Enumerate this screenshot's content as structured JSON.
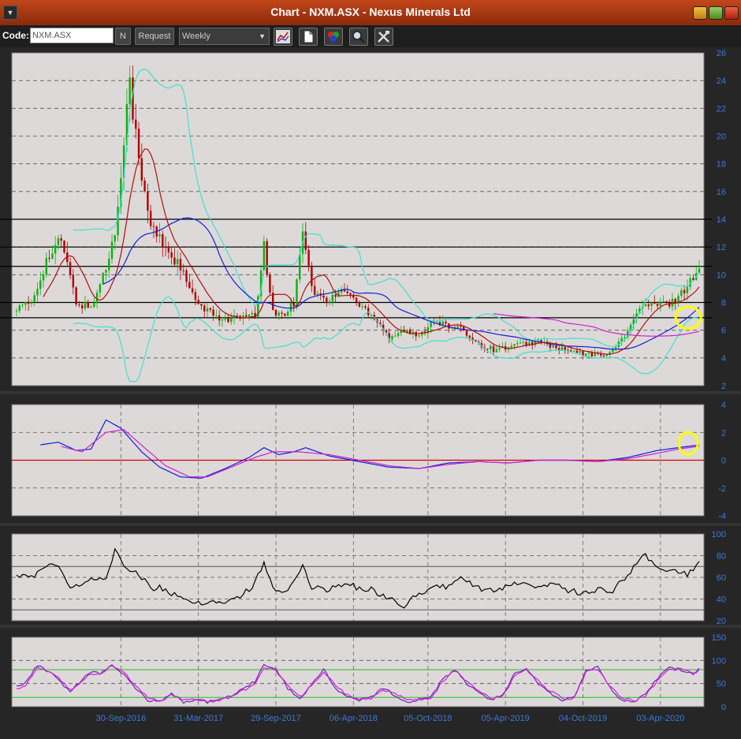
{
  "window": {
    "title": "Chart - NXM.ASX - Nexus Minerals Ltd"
  },
  "toolbar": {
    "code_label": "Code:",
    "code_value": "NXM.ASX",
    "n_label": "N",
    "request_label": "Request",
    "period_value": "Weekly"
  },
  "colors": {
    "background": "#ddd9d8",
    "ma_short": "#b01010",
    "ma_long": "#1020d8",
    "bollinger": "#40e0d0",
    "ma_very_long": "#d020d0",
    "highlight": "#ffff00",
    "up_candle": "#10b010",
    "down_candle": "#b00000"
  },
  "chart_data": [
    {
      "panel": "price",
      "type": "candlestick",
      "y_ticks": [
        "2",
        "4",
        "6",
        "8",
        "10",
        "12",
        "14",
        "16",
        "18",
        "20",
        "22",
        "24",
        "26"
      ],
      "ylim": [
        2,
        26
      ],
      "horizontal_lines": [
        6.9,
        8.0,
        10.6,
        12.0,
        14.0
      ],
      "weeks": 230,
      "close_anchors": [
        [
          0,
          7.5
        ],
        [
          5,
          8.0
        ],
        [
          10,
          11.0
        ],
        [
          15,
          12.5
        ],
        [
          20,
          8.0
        ],
        [
          25,
          7.6
        ],
        [
          30,
          10.5
        ],
        [
          33,
          13.0
        ],
        [
          36,
          20.0
        ],
        [
          38,
          24.0
        ],
        [
          41,
          18.0
        ],
        [
          45,
          13.5
        ],
        [
          50,
          12.0
        ],
        [
          55,
          10.5
        ],
        [
          60,
          8.0
        ],
        [
          65,
          7.2
        ],
        [
          70,
          6.8
        ],
        [
          75,
          6.9
        ],
        [
          80,
          7.0
        ],
        [
          83,
          12.0
        ],
        [
          86,
          7.2
        ],
        [
          90,
          7.2
        ],
        [
          93,
          8.0
        ],
        [
          96,
          13.5
        ],
        [
          99,
          9.0
        ],
        [
          104,
          8.0
        ],
        [
          110,
          9.0
        ],
        [
          115,
          7.8
        ],
        [
          120,
          7.0
        ],
        [
          125,
          5.5
        ],
        [
          130,
          6.0
        ],
        [
          135,
          5.5
        ],
        [
          140,
          6.8
        ],
        [
          145,
          6.2
        ],
        [
          150,
          6.0
        ],
        [
          155,
          5.0
        ],
        [
          160,
          4.6
        ],
        [
          165,
          4.8
        ],
        [
          170,
          5.0
        ],
        [
          175,
          5.2
        ],
        [
          180,
          4.8
        ],
        [
          185,
          4.5
        ],
        [
          190,
          4.3
        ],
        [
          195,
          4.2
        ],
        [
          200,
          4.5
        ],
        [
          205,
          6.0
        ],
        [
          210,
          7.8
        ],
        [
          215,
          7.8
        ],
        [
          220,
          8.0
        ],
        [
          225,
          9.2
        ],
        [
          229,
          10.6
        ]
      ],
      "highlight_circle": {
        "week": 224,
        "value": 6.9
      }
    },
    {
      "panel": "macd",
      "type": "line",
      "y_ticks": [
        "4",
        "2",
        "0",
        "-2",
        "-4"
      ],
      "ylim": [
        -4,
        4
      ],
      "series": [
        {
          "line": "blue",
          "anchors": [
            [
              8,
              1.1
            ],
            [
              14,
              1.3
            ],
            [
              20,
              0.7
            ],
            [
              25,
              0.8
            ],
            [
              30,
              2.9
            ],
            [
              35,
              2.3
            ],
            [
              42,
              0.6
            ],
            [
              48,
              -0.5
            ],
            [
              55,
              -1.2
            ],
            [
              62,
              -1.3
            ],
            [
              70,
              -0.6
            ],
            [
              78,
              0.2
            ],
            [
              83,
              0.9
            ],
            [
              88,
              0.4
            ],
            [
              93,
              0.6
            ],
            [
              97,
              0.9
            ],
            [
              105,
              0.3
            ],
            [
              115,
              -0.1
            ],
            [
              125,
              -0.5
            ],
            [
              135,
              -0.6
            ],
            [
              145,
              -0.2
            ],
            [
              155,
              -0.1
            ],
            [
              165,
              -0.2
            ],
            [
              175,
              0.0
            ],
            [
              185,
              0.0
            ],
            [
              195,
              -0.1
            ],
            [
              205,
              0.2
            ],
            [
              215,
              0.7
            ],
            [
              222,
              0.9
            ],
            [
              229,
              1.1
            ]
          ]
        },
        {
          "line": "magenta",
          "anchors": [
            [
              15,
              1.0
            ],
            [
              22,
              0.6
            ],
            [
              30,
              2.0
            ],
            [
              36,
              2.2
            ],
            [
              44,
              0.7
            ],
            [
              50,
              -0.4
            ],
            [
              58,
              -1.2
            ],
            [
              64,
              -1.2
            ],
            [
              72,
              -0.5
            ],
            [
              80,
              0.2
            ],
            [
              86,
              0.6
            ],
            [
              95,
              0.6
            ],
            [
              105,
              0.4
            ],
            [
              115,
              0.0
            ],
            [
              125,
              -0.4
            ],
            [
              135,
              -0.6
            ],
            [
              145,
              -0.3
            ],
            [
              155,
              -0.1
            ],
            [
              165,
              -0.2
            ],
            [
              175,
              0.0
            ],
            [
              185,
              0.0
            ],
            [
              195,
              -0.1
            ],
            [
              205,
              0.1
            ],
            [
              215,
              0.5
            ],
            [
              222,
              0.8
            ],
            [
              229,
              1.0
            ]
          ]
        }
      ],
      "zero_line": 0,
      "highlight_circle": {
        "week": 224,
        "value": 1.1
      }
    },
    {
      "panel": "rsi",
      "type": "line",
      "y_ticks": [
        "100",
        "80",
        "60",
        "40",
        "20"
      ],
      "ylim": [
        20,
        100
      ],
      "guide_lines": [
        70,
        30
      ],
      "series": [
        {
          "line": "black",
          "anchors": [
            [
              0,
              62
            ],
            [
              5,
              60
            ],
            [
              10,
              72
            ],
            [
              15,
              68
            ],
            [
              18,
              50
            ],
            [
              22,
              52
            ],
            [
              26,
              58
            ],
            [
              30,
              60
            ],
            [
              33,
              85
            ],
            [
              36,
              70
            ],
            [
              40,
              66
            ],
            [
              45,
              50
            ],
            [
              50,
              50
            ],
            [
              55,
              40
            ],
            [
              60,
              36
            ],
            [
              65,
              38
            ],
            [
              70,
              35
            ],
            [
              75,
              42
            ],
            [
              80,
              55
            ],
            [
              83,
              72
            ],
            [
              86,
              50
            ],
            [
              90,
              45
            ],
            [
              93,
              55
            ],
            [
              96,
              72
            ],
            [
              99,
              50
            ],
            [
              105,
              48
            ],
            [
              110,
              55
            ],
            [
              115,
              50
            ],
            [
              120,
              48
            ],
            [
              125,
              40
            ],
            [
              130,
              33
            ],
            [
              135,
              45
            ],
            [
              140,
              50
            ],
            [
              145,
              52
            ],
            [
              150,
              60
            ],
            [
              155,
              50
            ],
            [
              160,
              48
            ],
            [
              165,
              52
            ],
            [
              170,
              55
            ],
            [
              175,
              50
            ],
            [
              180,
              55
            ],
            [
              185,
              48
            ],
            [
              190,
              45
            ],
            [
              195,
              50
            ],
            [
              200,
              48
            ],
            [
              205,
              62
            ],
            [
              210,
              82
            ],
            [
              215,
              68
            ],
            [
              220,
              68
            ],
            [
              225,
              62
            ],
            [
              229,
              72
            ]
          ]
        }
      ]
    },
    {
      "panel": "stochastic",
      "type": "line",
      "y_ticks": [
        "150",
        "100",
        "50",
        "0"
      ],
      "ylim": [
        0,
        150
      ],
      "guide_lines": [
        80,
        20
      ],
      "x_ticks": [
        "30-Sep-2016",
        "31-Mar-2017",
        "29-Sep-2017",
        "06-Apr-2018",
        "05-Oct-2018",
        "05-Apr-2019",
        "04-Oct-2019",
        "03-Apr-2020"
      ],
      "x_tick_weeks": [
        35,
        61,
        87,
        113,
        138,
        164,
        190,
        216
      ],
      "series": [
        {
          "line": "purple",
          "anchors": [
            [
              0,
              45
            ],
            [
              3,
              50
            ],
            [
              7,
              90
            ],
            [
              11,
              75
            ],
            [
              14,
              60
            ],
            [
              18,
              30
            ],
            [
              22,
              60
            ],
            [
              25,
              75
            ],
            [
              28,
              70
            ],
            [
              32,
              90
            ],
            [
              36,
              70
            ],
            [
              40,
              40
            ],
            [
              44,
              15
            ],
            [
              48,
              10
            ],
            [
              52,
              30
            ],
            [
              56,
              10
            ],
            [
              60,
              15
            ],
            [
              64,
              10
            ],
            [
              68,
              15
            ],
            [
              72,
              25
            ],
            [
              76,
              40
            ],
            [
              80,
              55
            ],
            [
              83,
              90
            ],
            [
              87,
              80
            ],
            [
              91,
              40
            ],
            [
              95,
              15
            ],
            [
              99,
              50
            ],
            [
              103,
              80
            ],
            [
              107,
              40
            ],
            [
              111,
              20
            ],
            [
              115,
              15
            ],
            [
              119,
              20
            ],
            [
              123,
              40
            ],
            [
              127,
              25
            ],
            [
              131,
              10
            ],
            [
              135,
              15
            ],
            [
              139,
              20
            ],
            [
              143,
              60
            ],
            [
              147,
              80
            ],
            [
              151,
              50
            ],
            [
              155,
              30
            ],
            [
              159,
              15
            ],
            [
              163,
              25
            ],
            [
              167,
              70
            ],
            [
              171,
              85
            ],
            [
              175,
              50
            ],
            [
              179,
              30
            ],
            [
              183,
              15
            ],
            [
              187,
              20
            ],
            [
              191,
              80
            ],
            [
              195,
              85
            ],
            [
              199,
              40
            ],
            [
              203,
              15
            ],
            [
              207,
              10
            ],
            [
              211,
              30
            ],
            [
              215,
              60
            ],
            [
              219,
              85
            ],
            [
              223,
              80
            ],
            [
              227,
              70
            ],
            [
              229,
              85
            ]
          ]
        },
        {
          "line": "magenta",
          "anchors": [
            [
              0,
              40
            ],
            [
              3,
              45
            ],
            [
              7,
              85
            ],
            [
              11,
              78
            ],
            [
              14,
              62
            ],
            [
              18,
              35
            ],
            [
              22,
              55
            ],
            [
              25,
              72
            ],
            [
              28,
              72
            ],
            [
              32,
              88
            ],
            [
              36,
              75
            ],
            [
              40,
              45
            ],
            [
              44,
              20
            ],
            [
              48,
              12
            ],
            [
              52,
              25
            ],
            [
              56,
              14
            ],
            [
              60,
              14
            ],
            [
              64,
              12
            ],
            [
              68,
              13
            ],
            [
              72,
              22
            ],
            [
              76,
              35
            ],
            [
              80,
              50
            ],
            [
              83,
              85
            ],
            [
              87,
              82
            ],
            [
              91,
              45
            ],
            [
              95,
              20
            ],
            [
              99,
              45
            ],
            [
              103,
              75
            ],
            [
              107,
              45
            ],
            [
              111,
              24
            ],
            [
              115,
              17
            ],
            [
              119,
              19
            ],
            [
              123,
              35
            ],
            [
              127,
              28
            ],
            [
              131,
              14
            ],
            [
              135,
              14
            ],
            [
              139,
              18
            ],
            [
              143,
              55
            ],
            [
              147,
              78
            ],
            [
              151,
              55
            ],
            [
              155,
              34
            ],
            [
              159,
              18
            ],
            [
              163,
              22
            ],
            [
              167,
              65
            ],
            [
              171,
              82
            ],
            [
              175,
              55
            ],
            [
              179,
              34
            ],
            [
              183,
              18
            ],
            [
              187,
              18
            ],
            [
              191,
              75
            ],
            [
              195,
              82
            ],
            [
              199,
              45
            ],
            [
              203,
              20
            ],
            [
              207,
              12
            ],
            [
              211,
              25
            ],
            [
              215,
              55
            ],
            [
              219,
              80
            ],
            [
              223,
              82
            ],
            [
              227,
              72
            ],
            [
              229,
              80
            ]
          ]
        }
      ]
    }
  ]
}
